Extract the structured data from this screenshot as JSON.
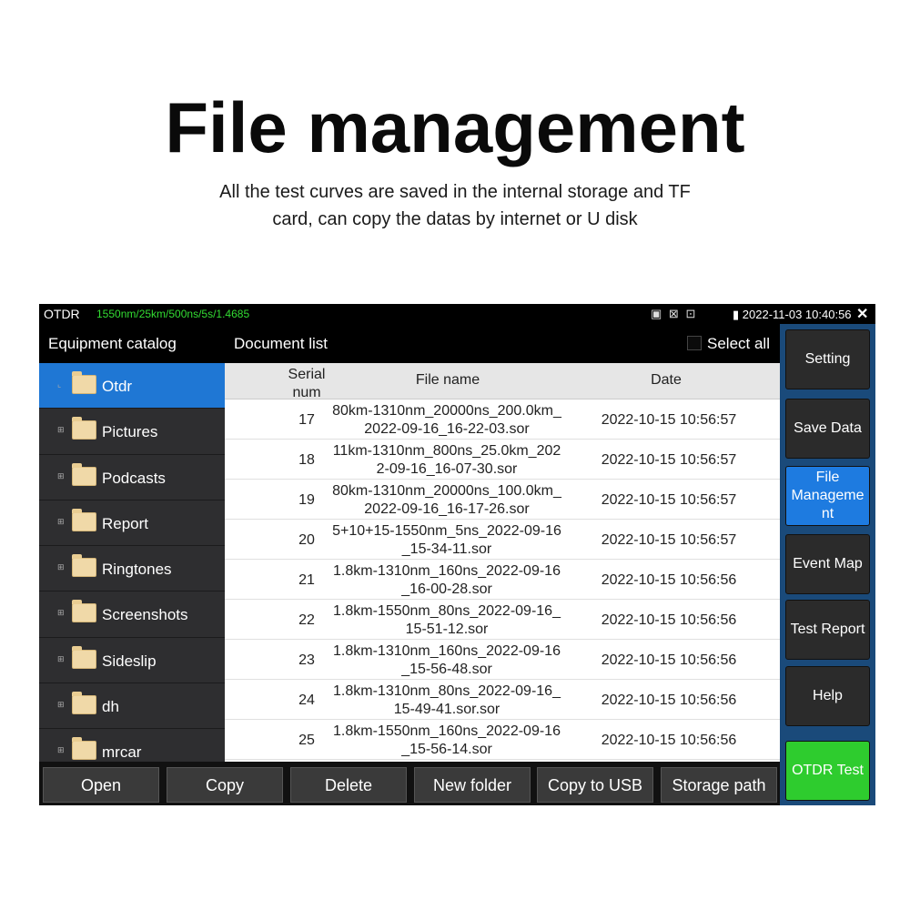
{
  "headline": "File management",
  "subtitle": [
    "All the test curves are saved in the internal storage and TF",
    "card, can copy the datas by internet or U disk"
  ],
  "status": {
    "app": "OTDR",
    "params": "1550nm/25km/500ns/5s/1.4685",
    "datetime": "2022-11-03 10:40:56",
    "close": "✕"
  },
  "catalog": {
    "title": "Equipment catalog",
    "items": [
      {
        "label": "Otdr",
        "expand": "⌞",
        "selected": true
      },
      {
        "label": "Pictures",
        "expand": "⊞"
      },
      {
        "label": "Podcasts",
        "expand": "⊞"
      },
      {
        "label": "Report",
        "expand": "⊞"
      },
      {
        "label": "Ringtones",
        "expand": "⊞"
      },
      {
        "label": "Screenshots",
        "expand": "⊞"
      },
      {
        "label": "Sideslip",
        "expand": "⊞"
      },
      {
        "label": "dh",
        "expand": "⊞"
      },
      {
        "label": "mrcar",
        "expand": "⊞"
      }
    ]
  },
  "doclist": {
    "title": "Document list",
    "select_all": "Select all",
    "columns": {
      "serial": "Serial num",
      "file": "File name",
      "date": "Date"
    },
    "rows": [
      {
        "serial": "17",
        "file": "80km-1310nm_20000ns_200.0km_2022-09-16_16-22-03.sor",
        "date": "2022-10-15 10:56:57"
      },
      {
        "serial": "18",
        "file": "11km-1310nm_800ns_25.0km_2022-09-16_16-07-30.sor",
        "date": "2022-10-15 10:56:57"
      },
      {
        "serial": "19",
        "file": "80km-1310nm_20000ns_100.0km_2022-09-16_16-17-26.sor",
        "date": "2022-10-15 10:56:57"
      },
      {
        "serial": "20",
        "file": "5+10+15-1550nm_5ns_2022-09-16_15-34-11.sor",
        "date": "2022-10-15 10:56:57"
      },
      {
        "serial": "21",
        "file": "1.8km-1310nm_160ns_2022-09-16_16-00-28.sor",
        "date": "2022-10-15 10:56:56"
      },
      {
        "serial": "22",
        "file": "1.8km-1550nm_80ns_2022-09-16_15-51-12.sor",
        "date": "2022-10-15 10:56:56"
      },
      {
        "serial": "23",
        "file": "1.8km-1310nm_160ns_2022-09-16_15-56-48.sor",
        "date": "2022-10-15 10:56:56"
      },
      {
        "serial": "24",
        "file": "1.8km-1310nm_80ns_2022-09-16_15-49-41.sor.sor",
        "date": "2022-10-15 10:56:56"
      },
      {
        "serial": "25",
        "file": "1.8km-1550nm_160ns_2022-09-16_15-56-14.sor",
        "date": "2022-10-15 10:56:56"
      }
    ]
  },
  "toolbar": {
    "open": "Open",
    "copy": "Copy",
    "delete": "Delete",
    "new_folder": "New folder",
    "copy_usb": "Copy to USB",
    "storage_path": "Storage path"
  },
  "side": {
    "setting": "Setting",
    "save_data": "Save Data",
    "file_mgmt": "File Manageme nt",
    "event_map": "Event Map",
    "test_report": "Test Report",
    "help": "Help",
    "otdr_test": "OTDR Test"
  }
}
